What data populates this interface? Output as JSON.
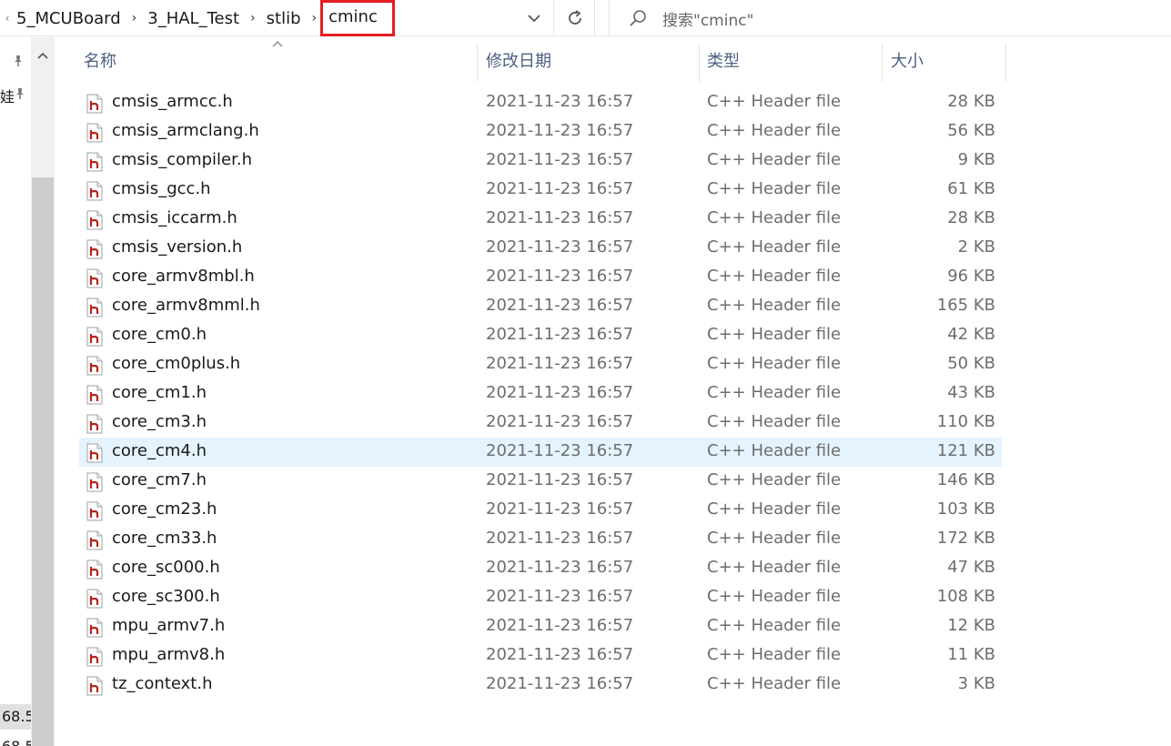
{
  "address_bar": {
    "breadcrumbs": [
      "5_MCUBoard",
      "3_HAL_Test",
      "stlib",
      "cminc"
    ],
    "dropdown_icon": "chevron-down-icon",
    "refresh_icon": "refresh-icon"
  },
  "search": {
    "placeholder": "搜索\"cminc\"",
    "icon": "search-icon"
  },
  "nav": {
    "item_fragment": "娃",
    "value_1": "68.5",
    "value_2": "68.5"
  },
  "columns": {
    "name": "名称",
    "date": "修改日期",
    "type": "类型",
    "size": "大小"
  },
  "files": [
    {
      "name": "cmsis_armcc.h",
      "date": "2021-11-23 16:57",
      "type": "C++ Header file",
      "size": "28 KB"
    },
    {
      "name": "cmsis_armclang.h",
      "date": "2021-11-23 16:57",
      "type": "C++ Header file",
      "size": "56 KB"
    },
    {
      "name": "cmsis_compiler.h",
      "date": "2021-11-23 16:57",
      "type": "C++ Header file",
      "size": "9 KB"
    },
    {
      "name": "cmsis_gcc.h",
      "date": "2021-11-23 16:57",
      "type": "C++ Header file",
      "size": "61 KB"
    },
    {
      "name": "cmsis_iccarm.h",
      "date": "2021-11-23 16:57",
      "type": "C++ Header file",
      "size": "28 KB"
    },
    {
      "name": "cmsis_version.h",
      "date": "2021-11-23 16:57",
      "type": "C++ Header file",
      "size": "2 KB"
    },
    {
      "name": "core_armv8mbl.h",
      "date": "2021-11-23 16:57",
      "type": "C++ Header file",
      "size": "96 KB"
    },
    {
      "name": "core_armv8mml.h",
      "date": "2021-11-23 16:57",
      "type": "C++ Header file",
      "size": "165 KB"
    },
    {
      "name": "core_cm0.h",
      "date": "2021-11-23 16:57",
      "type": "C++ Header file",
      "size": "42 KB"
    },
    {
      "name": "core_cm0plus.h",
      "date": "2021-11-23 16:57",
      "type": "C++ Header file",
      "size": "50 KB"
    },
    {
      "name": "core_cm1.h",
      "date": "2021-11-23 16:57",
      "type": "C++ Header file",
      "size": "43 KB"
    },
    {
      "name": "core_cm3.h",
      "date": "2021-11-23 16:57",
      "type": "C++ Header file",
      "size": "110 KB"
    },
    {
      "name": "core_cm4.h",
      "date": "2021-11-23 16:57",
      "type": "C++ Header file",
      "size": "121 KB",
      "selected": true
    },
    {
      "name": "core_cm7.h",
      "date": "2021-11-23 16:57",
      "type": "C++ Header file",
      "size": "146 KB"
    },
    {
      "name": "core_cm23.h",
      "date": "2021-11-23 16:57",
      "type": "C++ Header file",
      "size": "103 KB"
    },
    {
      "name": "core_cm33.h",
      "date": "2021-11-23 16:57",
      "type": "C++ Header file",
      "size": "172 KB"
    },
    {
      "name": "core_sc000.h",
      "date": "2021-11-23 16:57",
      "type": "C++ Header file",
      "size": "47 KB"
    },
    {
      "name": "core_sc300.h",
      "date": "2021-11-23 16:57",
      "type": "C++ Header file",
      "size": "108 KB"
    },
    {
      "name": "mpu_armv7.h",
      "date": "2021-11-23 16:57",
      "type": "C++ Header file",
      "size": "12 KB"
    },
    {
      "name": "mpu_armv8.h",
      "date": "2021-11-23 16:57",
      "type": "C++ Header file",
      "size": "11 KB"
    },
    {
      "name": "tz_context.h",
      "date": "2021-11-23 16:57",
      "type": "C++ Header file",
      "size": "3 KB"
    }
  ],
  "colors": {
    "accent_highlight": "#e51c23",
    "selection": "#e5f3ff",
    "header_text": "#4d6082"
  }
}
